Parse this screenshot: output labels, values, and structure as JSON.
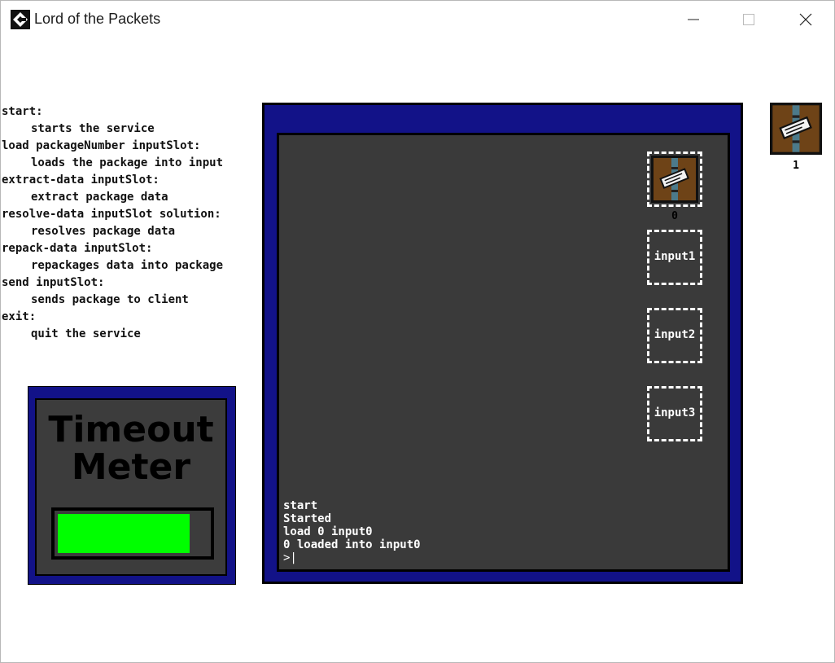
{
  "window": {
    "title": "Lord of the Packets",
    "icons": {
      "app": "game-maker-icon",
      "minimize": "minimize-icon",
      "maximize": "maximize-icon",
      "close": "close-icon"
    }
  },
  "commands": [
    {
      "syntax": "start:",
      "description": "starts the service"
    },
    {
      "syntax": "load packageNumber inputSlot:",
      "description": "loads the package into input"
    },
    {
      "syntax": "extract-data inputSlot:",
      "description": "extract package data"
    },
    {
      "syntax": "resolve-data inputSlot solution:",
      "description": "resolves package data"
    },
    {
      "syntax": "repack-data inputSlot:",
      "description": "repackages data into package"
    },
    {
      "syntax": "send inputSlot:",
      "description": "sends package to client"
    },
    {
      "syntax": "exit:",
      "description": "quit the service"
    }
  ],
  "timeout_meter": {
    "title_line1": "Timeout",
    "title_line2": "Meter",
    "level": 0.88,
    "fill_color": "#00ff00"
  },
  "console": {
    "log": [
      "start",
      "Started",
      "load 0 input0",
      "0 loaded into input0"
    ],
    "prompt": ">|"
  },
  "slots": [
    {
      "label": "",
      "package_count": "0",
      "has_package": true
    },
    {
      "label": "input1",
      "package_count": "",
      "has_package": false
    },
    {
      "label": "input2",
      "package_count": "",
      "has_package": false
    },
    {
      "label": "input3",
      "package_count": "",
      "has_package": false
    }
  ],
  "inventory": {
    "package_count": "1",
    "icon": "package-icon"
  },
  "colors": {
    "frame_blue": "#121288",
    "panel_gray": "#3a3a3a",
    "crate_brown": "#6e4317"
  }
}
